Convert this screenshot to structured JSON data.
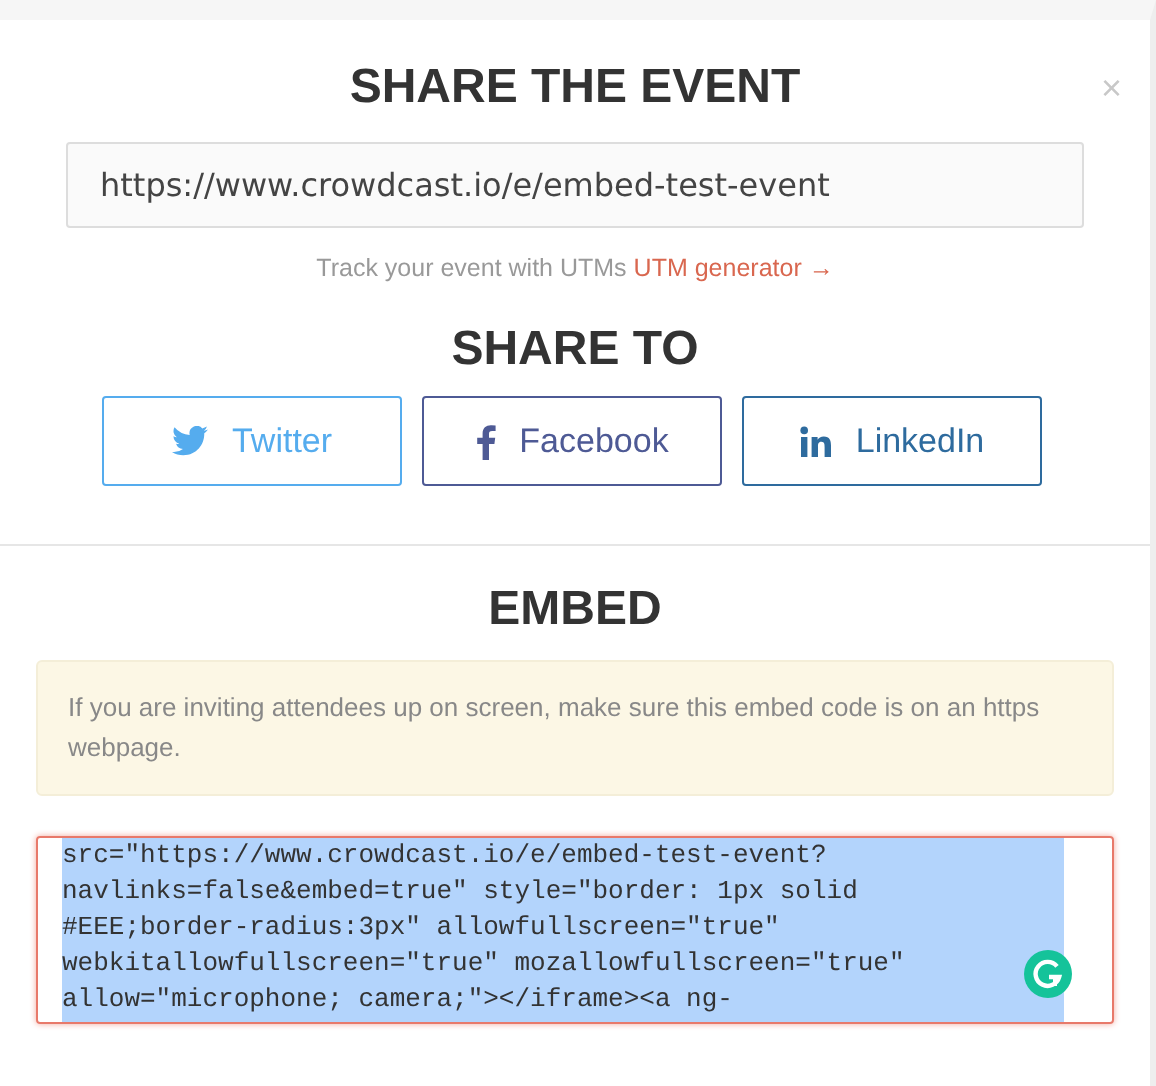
{
  "title": "SHARE THE EVENT",
  "close": "×",
  "url_field": {
    "value": "https://www.crowdcast.io/e/embed-test-event"
  },
  "utm": {
    "text": "Track your event with UTMs",
    "link": "UTM generator →"
  },
  "share_heading": "SHARE TO",
  "share_buttons": [
    {
      "kind": "twitter",
      "label": "Twitter",
      "color": "#55acee"
    },
    {
      "kind": "facebook",
      "label": "Facebook",
      "color": "#4e5a95"
    },
    {
      "kind": "linkedin",
      "label": "LinkedIn",
      "color": "#2e6b9e"
    }
  ],
  "embed_heading": "EMBED",
  "notice": "If you are inviting attendees up on screen, make sure this embed code is on an https webpage.",
  "embed_code": {
    "selected": true,
    "lines": [
      "src=\"https://www.crowdcast.io/e/embed-test-event?",
      "navlinks=false&embed=true\" style=\"border: 1px solid",
      "#EEE;border-radius:3px\" allowfullscreen=\"true\"",
      "webkitallowfullscreen=\"true\" mozallowfullscreen=\"true\"",
      "allow=\"microphone; camera;\"></iframe><a ng-"
    ]
  }
}
